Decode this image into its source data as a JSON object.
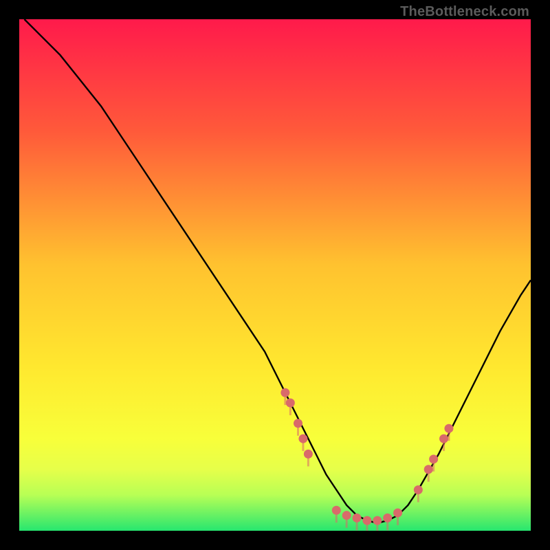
{
  "attribution": "TheBottleneck.com",
  "chart_data": {
    "type": "line",
    "title": "",
    "xlabel": "",
    "ylabel": "",
    "xlim": [
      0,
      100
    ],
    "ylim": [
      0,
      100
    ],
    "background_gradient": {
      "top": "#ff1a4b",
      "mid_upper": "#ffd02f",
      "mid_lower": "#f4ff3a",
      "green_band_top": "#d6ff52",
      "green_band_bottom": "#27e66f"
    },
    "series": [
      {
        "name": "bottleneck-curve",
        "x": [
          1,
          4,
          8,
          12,
          16,
          20,
          24,
          28,
          32,
          36,
          40,
          44,
          48,
          52,
          54,
          56,
          58,
          60,
          62,
          64,
          66,
          68,
          70,
          72,
          74,
          76,
          78,
          82,
          86,
          90,
          94,
          98,
          100
        ],
        "y": [
          100,
          97,
          93,
          88,
          83,
          77,
          71,
          65,
          59,
          53,
          47,
          41,
          35,
          27,
          23,
          19,
          15,
          11,
          8,
          5,
          3,
          2,
          1.5,
          2,
          3,
          5,
          8,
          15,
          23,
          31,
          39,
          46,
          49
        ]
      }
    ],
    "markers": {
      "name": "highlighted-points",
      "color": "#d96a6a",
      "points": [
        {
          "x": 52,
          "y": 27
        },
        {
          "x": 53,
          "y": 25
        },
        {
          "x": 54.5,
          "y": 21
        },
        {
          "x": 55.5,
          "y": 18
        },
        {
          "x": 56.5,
          "y": 15
        },
        {
          "x": 62,
          "y": 4
        },
        {
          "x": 64,
          "y": 3
        },
        {
          "x": 66,
          "y": 2.5
        },
        {
          "x": 68,
          "y": 2
        },
        {
          "x": 70,
          "y": 2
        },
        {
          "x": 72,
          "y": 2.5
        },
        {
          "x": 74,
          "y": 3.5
        },
        {
          "x": 78,
          "y": 8
        },
        {
          "x": 80,
          "y": 12
        },
        {
          "x": 81,
          "y": 14
        },
        {
          "x": 83,
          "y": 18
        },
        {
          "x": 84,
          "y": 20
        }
      ]
    }
  }
}
